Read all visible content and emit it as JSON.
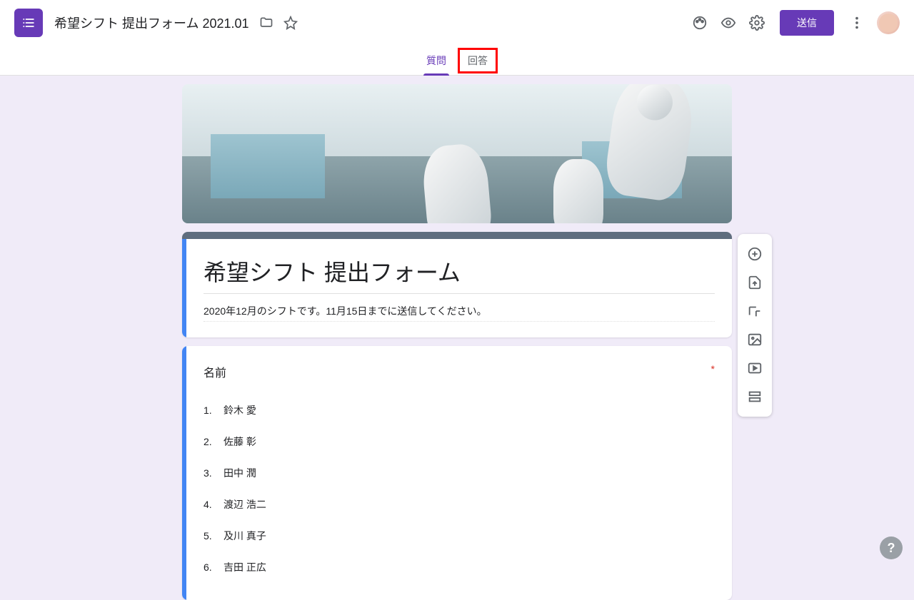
{
  "header": {
    "doc_title": "希望シフト 提出フォーム 2021.01",
    "send_label": "送信"
  },
  "tabs": {
    "questions": "質問",
    "responses": "回答"
  },
  "form": {
    "title": "希望シフト 提出フォーム",
    "description": "2020年12月のシフトです。11月15日までに送信してください。"
  },
  "question": {
    "title": "名前",
    "required_mark": "*",
    "options": [
      {
        "num": "1.",
        "text": "鈴木 愛"
      },
      {
        "num": "2.",
        "text": "佐藤 彰"
      },
      {
        "num": "3.",
        "text": "田中 潤"
      },
      {
        "num": "4.",
        "text": "渡辺 浩二"
      },
      {
        "num": "5.",
        "text": "及川 真子"
      },
      {
        "num": "6.",
        "text": "吉田 正広"
      }
    ]
  },
  "help": "?"
}
